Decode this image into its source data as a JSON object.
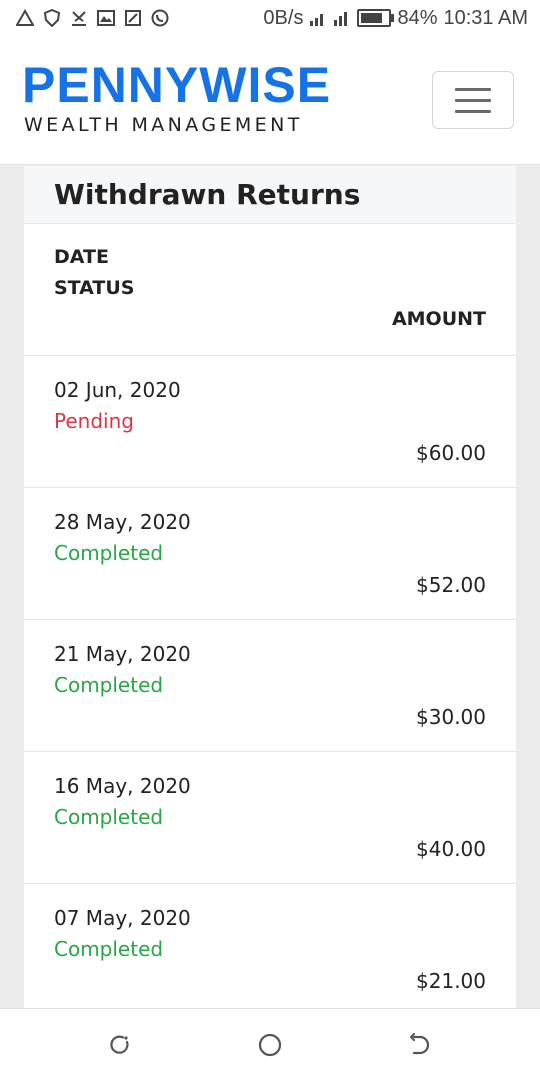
{
  "status_bar": {
    "icons": [
      "warning-icon",
      "shield-icon",
      "missed-call-icon",
      "gallery-icon",
      "screenshot-icon",
      "whatsapp-icon"
    ],
    "network_speed": "0B/s",
    "battery": "84%",
    "time": "10:31 AM"
  },
  "header": {
    "brand": "PENNYWISE",
    "subtitle": "WEALTH MANAGEMENT",
    "brand_color": "#1673e6"
  },
  "card": {
    "title": "Withdrawn Returns",
    "columns": {
      "date": "DATE",
      "status": "STATUS",
      "amount": "AMOUNT"
    },
    "rows": [
      {
        "date": "02 Jun, 2020",
        "status": "Pending",
        "amount": "$60.00"
      },
      {
        "date": "28 May, 2020",
        "status": "Completed",
        "amount": "$52.00"
      },
      {
        "date": "21 May, 2020",
        "status": "Completed",
        "amount": "$30.00"
      },
      {
        "date": "16 May, 2020",
        "status": "Completed",
        "amount": "$40.00"
      },
      {
        "date": "07 May, 2020",
        "status": "Completed",
        "amount": "$21.00"
      }
    ]
  },
  "colors": {
    "pending": "#dc3545",
    "completed": "#28a745"
  },
  "nav_bar": {
    "icons": [
      "recent-apps-icon",
      "home-icon",
      "back-icon"
    ]
  }
}
